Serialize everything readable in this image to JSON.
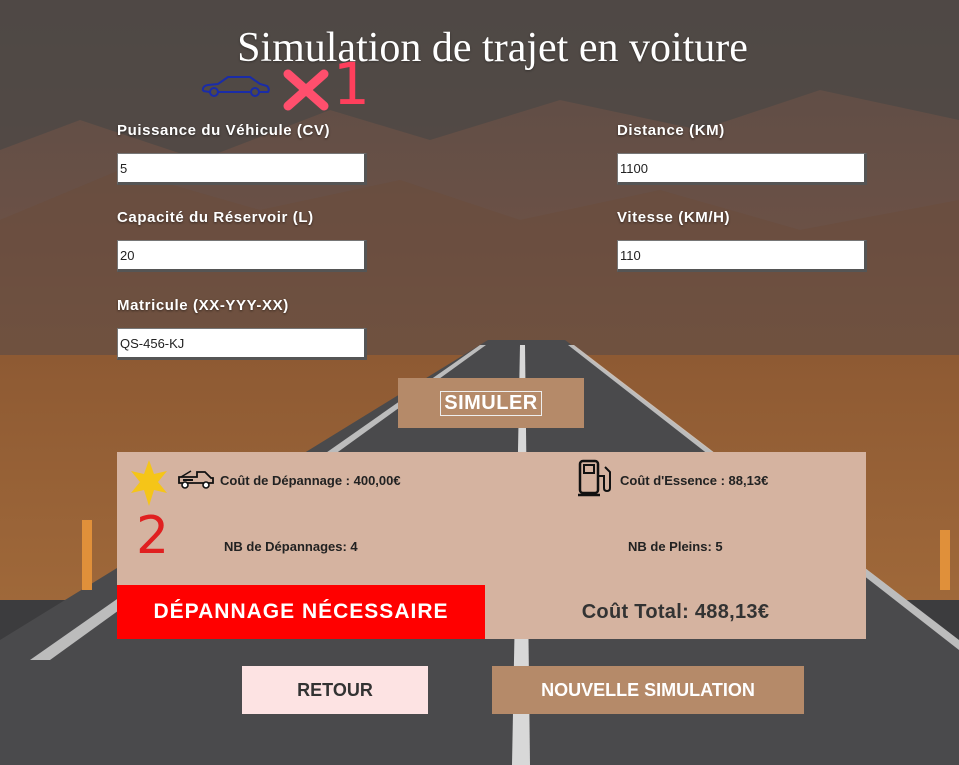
{
  "title": "Simulation de trajet en voiture",
  "badge_count": "1",
  "form": {
    "power_label": "Puissance du Véhicule (CV)",
    "power_value": "5",
    "tank_label": "Capacité du Réservoir (L)",
    "tank_value": "20",
    "plate_label": "Matricule (XX-YYY-XX)",
    "plate_value": "QS-456-KJ",
    "distance_label": "Distance (KM)",
    "distance_value": "1100",
    "speed_label": "Vitesse (KM/H)",
    "speed_value": "110"
  },
  "simulate_label": "SIMULER",
  "results": {
    "step_number": "2",
    "tow_cost": "Coût de Dépannage : 400,00€",
    "fuel_cost": "Coût d'Essence : 88,13€",
    "tow_count": "NB de Dépannages: 4",
    "fill_count": "NB de Pleins: 5",
    "warning": "DÉPANNAGE NÉCESSAIRE",
    "total": "Coût Total: 488,13€"
  },
  "buttons": {
    "back": "RETOUR",
    "new_sim": "NOUVELLE SIMULATION"
  },
  "icons": {
    "car": "car-outline-icon",
    "cross": "cross-icon",
    "star": "star-icon",
    "tow": "tow-truck-icon",
    "fuel": "fuel-pump-icon"
  },
  "colors": {
    "accent_brown": "#b58a69",
    "panel": "#d5b3a0",
    "warning_red": "#ff0000",
    "star_yellow": "#f5c518",
    "cross_pink": "#ff4f6d",
    "car_blue": "#1a2ca8"
  }
}
